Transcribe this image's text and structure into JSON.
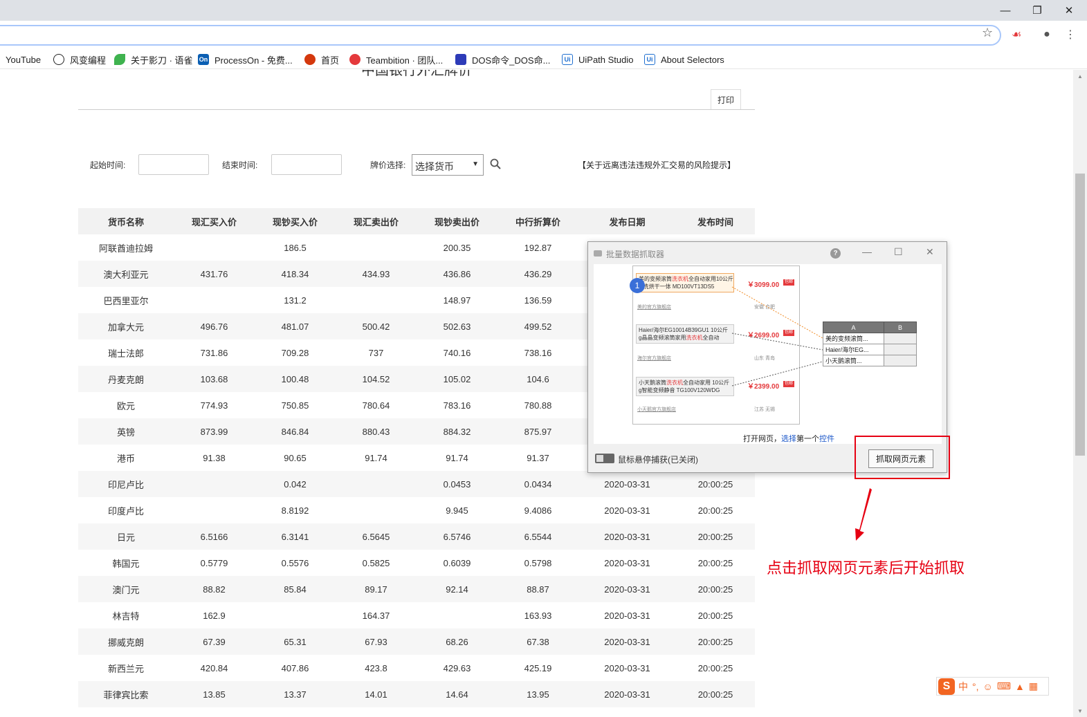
{
  "browser": {
    "bookmarks": [
      "YouTube",
      "风变编程",
      "关于影刀 · 语雀",
      "ProcessOn - 免费...",
      "首页",
      "Teambition · 团队...",
      "DOS命令_DOS命...",
      "UiPath Studio",
      "About Selectors"
    ],
    "bookmark_icon_text": [
      "",
      "",
      "",
      "On",
      "",
      "",
      "",
      "Ui",
      "Ui"
    ]
  },
  "page": {
    "title": "中国银行外汇牌价",
    "print_label": "打印",
    "start_label": "起始时间:",
    "end_label": "结束时间:",
    "select_label": "牌价选择:",
    "select_value": "选择货币",
    "risk_link": "【关于远离违法违规外汇交易的风险提示】"
  },
  "table": {
    "headers": [
      "货币名称",
      "现汇买入价",
      "现钞买入价",
      "现汇卖出价",
      "现钞卖出价",
      "中行折算价",
      "发布日期",
      "发布时间"
    ],
    "rows": [
      [
        "阿联酋迪拉姆",
        "",
        "186.5",
        "",
        "200.35",
        "192.87",
        "",
        ""
      ],
      [
        "澳大利亚元",
        "431.76",
        "418.34",
        "434.93",
        "436.86",
        "436.29",
        "",
        ""
      ],
      [
        "巴西里亚尔",
        "",
        "131.2",
        "",
        "148.97",
        "136.59",
        "",
        ""
      ],
      [
        "加拿大元",
        "496.76",
        "481.07",
        "500.42",
        "502.63",
        "499.52",
        "",
        ""
      ],
      [
        "瑞士法郎",
        "731.86",
        "709.28",
        "737",
        "740.16",
        "738.16",
        "",
        ""
      ],
      [
        "丹麦克朗",
        "103.68",
        "100.48",
        "104.52",
        "105.02",
        "104.6",
        "",
        ""
      ],
      [
        "欧元",
        "774.93",
        "750.85",
        "780.64",
        "783.16",
        "780.88",
        "",
        ""
      ],
      [
        "英镑",
        "873.99",
        "846.84",
        "880.43",
        "884.32",
        "875.97",
        "",
        ""
      ],
      [
        "港币",
        "91.38",
        "90.65",
        "91.74",
        "91.74",
        "91.37",
        "",
        ""
      ],
      [
        "印尼卢比",
        "",
        "0.042",
        "",
        "0.0453",
        "0.0434",
        "2020-03-31",
        "20:00:25"
      ],
      [
        "印度卢比",
        "",
        "8.8192",
        "",
        "9.945",
        "9.4086",
        "2020-03-31",
        "20:00:25"
      ],
      [
        "日元",
        "6.5166",
        "6.3141",
        "6.5645",
        "6.5746",
        "6.5544",
        "2020-03-31",
        "20:00:25"
      ],
      [
        "韩国元",
        "0.5779",
        "0.5576",
        "0.5825",
        "0.6039",
        "0.5798",
        "2020-03-31",
        "20:00:25"
      ],
      [
        "澳门元",
        "88.82",
        "85.84",
        "89.17",
        "92.14",
        "88.87",
        "2020-03-31",
        "20:00:25"
      ],
      [
        "林吉特",
        "162.9",
        "",
        "164.37",
        "",
        "163.93",
        "2020-03-31",
        "20:00:25"
      ],
      [
        "挪威克朗",
        "67.39",
        "65.31",
        "67.93",
        "68.26",
        "67.38",
        "2020-03-31",
        "20:00:25"
      ],
      [
        "新西兰元",
        "420.84",
        "407.86",
        "423.8",
        "429.63",
        "425.19",
        "2020-03-31",
        "20:00:25"
      ],
      [
        "菲律宾比索",
        "13.85",
        "13.37",
        "14.01",
        "14.64",
        "13.95",
        "2020-03-31",
        "20:00:25"
      ]
    ]
  },
  "dialog": {
    "title": "批量数据抓取器",
    "help": "?",
    "badge": "1",
    "products": [
      {
        "pre": "美的变频滚筒",
        "hl": "洗衣机",
        "post": "全自动家用10公斤",
        "line2": "g 洗烘干一体 MD100VT13DS5",
        "price": "￥3099.00",
        "tag": "包邮",
        "shop": "美的官方旗舰店",
        "loc": "安徽 合肥"
      },
      {
        "pre": "Haier/海尔EG10014B39GU1 10公斤",
        "hl": "",
        "post": "",
        "line2pre": "g晶晶变频滚筒家用",
        "line2hl": "洗衣机",
        "line2post": "全自动",
        "price": "￥2699.00",
        "tag": "包邮",
        "shop": "海尔官方旗舰店",
        "loc": "山东 青岛"
      },
      {
        "pre": "小天鹅滚筒",
        "hl": "洗衣机",
        "post": "全自动家用 10公斤",
        "line2": "g智能变频静音 TG100V120WDG",
        "price": "￥2399.00",
        "tag": "包邮",
        "shop": "小天鹅官方旗舰店",
        "loc": "江苏 无锡"
      }
    ],
    "sheet_headers": [
      "A",
      "B"
    ],
    "sheet_rows": [
      "美的变频滚筒...",
      "Haier/海尔EG...",
      "小天鹅滚筒..."
    ],
    "caption_pre": "打开网页，",
    "caption_sel": "选择",
    "caption_mid": "第一个",
    "caption_ctrl": "控件",
    "hover_label": "鼠标悬停捕获(已关闭)",
    "grab_button": "抓取网页元素"
  },
  "annotation": {
    "text": "点击抓取网页元素后开始抓取",
    "color": "#e60012"
  },
  "ime": {
    "logo": "S",
    "lang": "中",
    "punct": "°,"
  }
}
